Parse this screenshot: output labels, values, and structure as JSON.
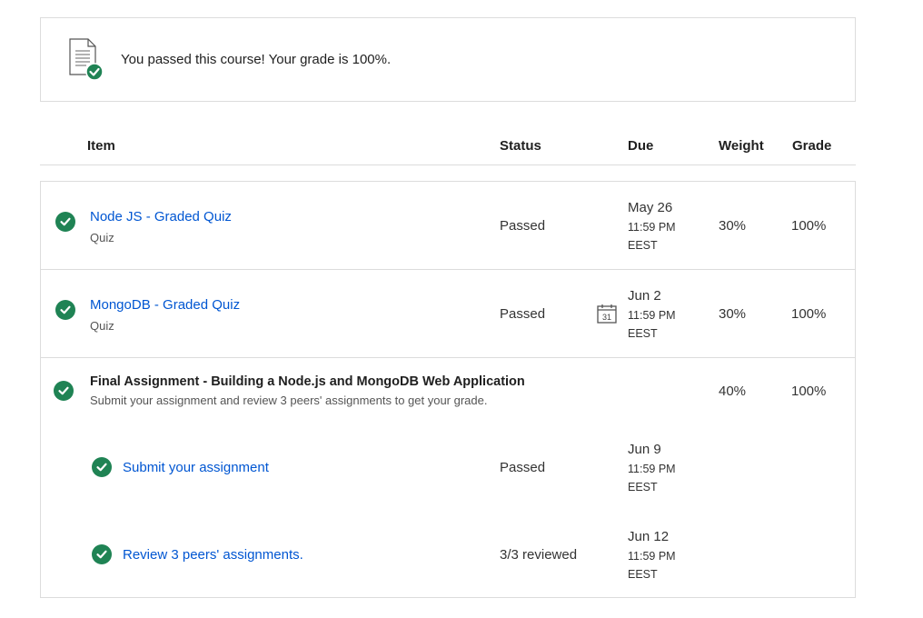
{
  "banner": {
    "message": "You passed this course! Your grade is 100%.",
    "icon": "document-check-icon"
  },
  "columns": {
    "item": "Item",
    "status": "Status",
    "due": "Due",
    "weight": "Weight",
    "grade": "Grade"
  },
  "rows": [
    {
      "title": "Node JS - Graded Quiz",
      "type": "Quiz",
      "status": "Passed",
      "due_date": "May 26",
      "due_time": "11:59 PM",
      "due_tz": "EEST",
      "weight": "30%",
      "grade": "100%"
    },
    {
      "title": "MongoDB - Graded Quiz",
      "type": "Quiz",
      "status": "Passed",
      "due_date": "Jun 2",
      "due_time": "11:59 PM",
      "due_tz": "EEST",
      "weight": "30%",
      "grade": "100%",
      "calendar_day": "31"
    }
  ],
  "assignment": {
    "title": "Final Assignment - Building a Node.js and MongoDB Web Application",
    "description": "Submit your assignment and review 3 peers' assignments to get your grade.",
    "weight": "40%",
    "grade": "100%",
    "subitems": [
      {
        "title": "Submit your assignment",
        "status": "Passed",
        "due_date": "Jun 9",
        "due_time": "11:59 PM",
        "due_tz": "EEST"
      },
      {
        "title": "Review 3 peers' assignments.",
        "status": "3/3 reviewed",
        "due_date": "Jun 12",
        "due_time": "11:59 PM",
        "due_tz": "EEST"
      }
    ]
  },
  "colors": {
    "accent_link": "#0056d2",
    "success": "#1f8354",
    "border": "#dcdcdc"
  }
}
